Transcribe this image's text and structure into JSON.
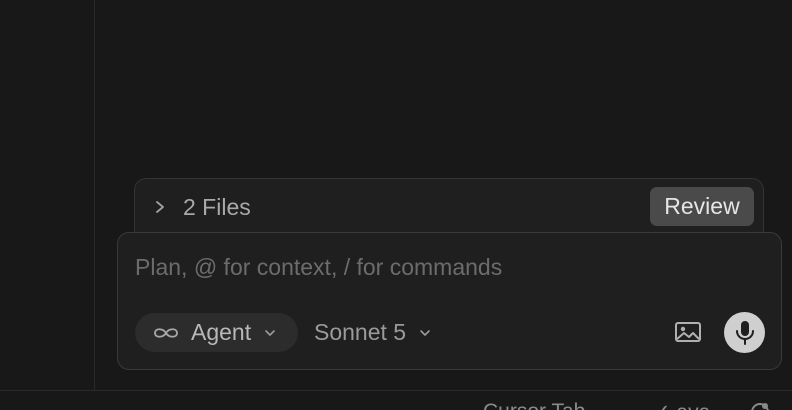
{
  "files_bar": {
    "label": "2 Files",
    "review_label": "Review"
  },
  "composer": {
    "placeholder": "Plan, @ for context, / for commands",
    "mode_label": "Agent",
    "model_label": "Sonnet 5"
  },
  "status_bar": {
    "tab_label": "Cursor Tab",
    "check_label": "✓ ava"
  },
  "icons": {
    "files_toggle": "chevron-right-icon",
    "mode": "infinity-icon",
    "dropdown": "chevron-down-icon",
    "image": "image-icon",
    "mic": "microphone-icon",
    "status": "bell-icon"
  },
  "colors": {
    "background": "#181818",
    "panel": "#1f1f1f",
    "review_button": "#4a4a4a",
    "mic_button": "#cfcfcf"
  }
}
